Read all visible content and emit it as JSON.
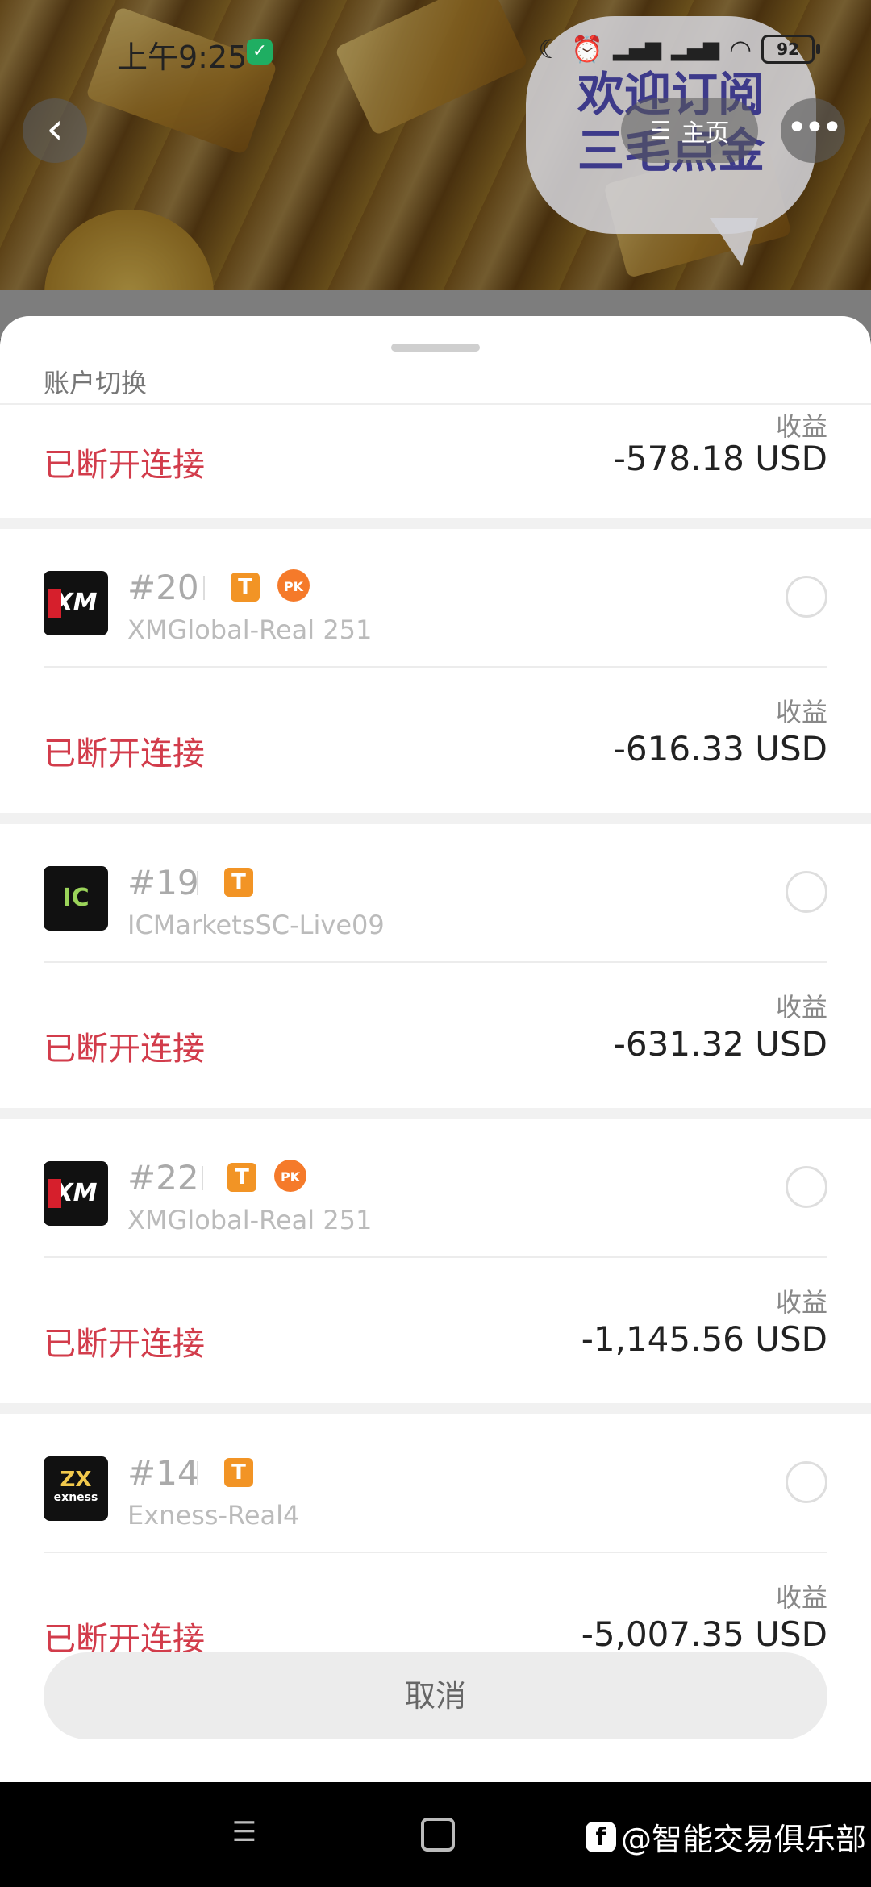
{
  "status_bar": {
    "time": "上午9:25",
    "battery": "92"
  },
  "header": {
    "home_label": "主页",
    "bubble_line1": "欢迎订阅",
    "bubble_line2": "三毛点金"
  },
  "sheet": {
    "title": "账户切换",
    "profit_label": "收益",
    "status_disconnected": "已断开连接",
    "cancel_label": "取消",
    "first_partial": {
      "profit": "-578.18 USD"
    },
    "accounts": [
      {
        "number": "#20",
        "server": "XMGlobal-Real 251",
        "broker_logo": "XM",
        "tags": [
          "T",
          "PK"
        ],
        "profit": "-616.33 USD"
      },
      {
        "number": "#19",
        "server": "ICMarketsSC-Live09",
        "broker_logo": "IC",
        "tags": [
          "T"
        ],
        "profit": "-631.32 USD"
      },
      {
        "number": "#22",
        "server": "XMGlobal-Real 251",
        "broker_logo": "XM",
        "tags": [
          "T",
          "PK"
        ],
        "profit": "-1,145.56 USD"
      },
      {
        "number": "#14",
        "server": "Exness-Real4",
        "broker_logo": "exness",
        "tags": [
          "T"
        ],
        "profit": "-5,007.35 USD"
      }
    ]
  },
  "watermark": {
    "text": "@智能交易俱乐部"
  },
  "colors": {
    "disconnected": "#d23c4b",
    "tag_orange": "#f29425"
  }
}
